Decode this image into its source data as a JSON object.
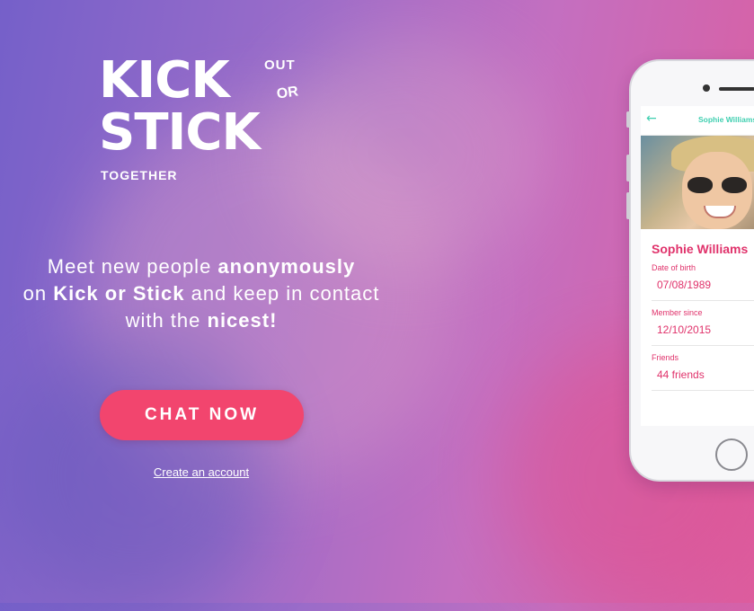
{
  "logo": {
    "kick": "KICK",
    "out": "OUT",
    "or": "OR",
    "stick": "STICK",
    "together": "TOGETHER"
  },
  "tagline": {
    "part1": "Meet new people ",
    "bold1": "anonymously",
    "part2": "on ",
    "bold2": "Kick or Stick",
    "part3": " and keep in contact with the ",
    "bold3": "nicest!"
  },
  "cta": {
    "label": "CHAT NOW"
  },
  "create_account": {
    "label": "Create an account"
  },
  "phone": {
    "header_title": "Sophie Williams",
    "profile_name": "Sophie Williams",
    "fields": [
      {
        "label": "Date of birth",
        "value": "07/08/1989"
      },
      {
        "label": "Member since",
        "value": "12/10/2015"
      },
      {
        "label": "Friends",
        "value": "44 friends"
      }
    ]
  },
  "colors": {
    "accent": "#f2456e",
    "profile_pink": "#e0326b",
    "app_teal": "#3fcfb0"
  }
}
